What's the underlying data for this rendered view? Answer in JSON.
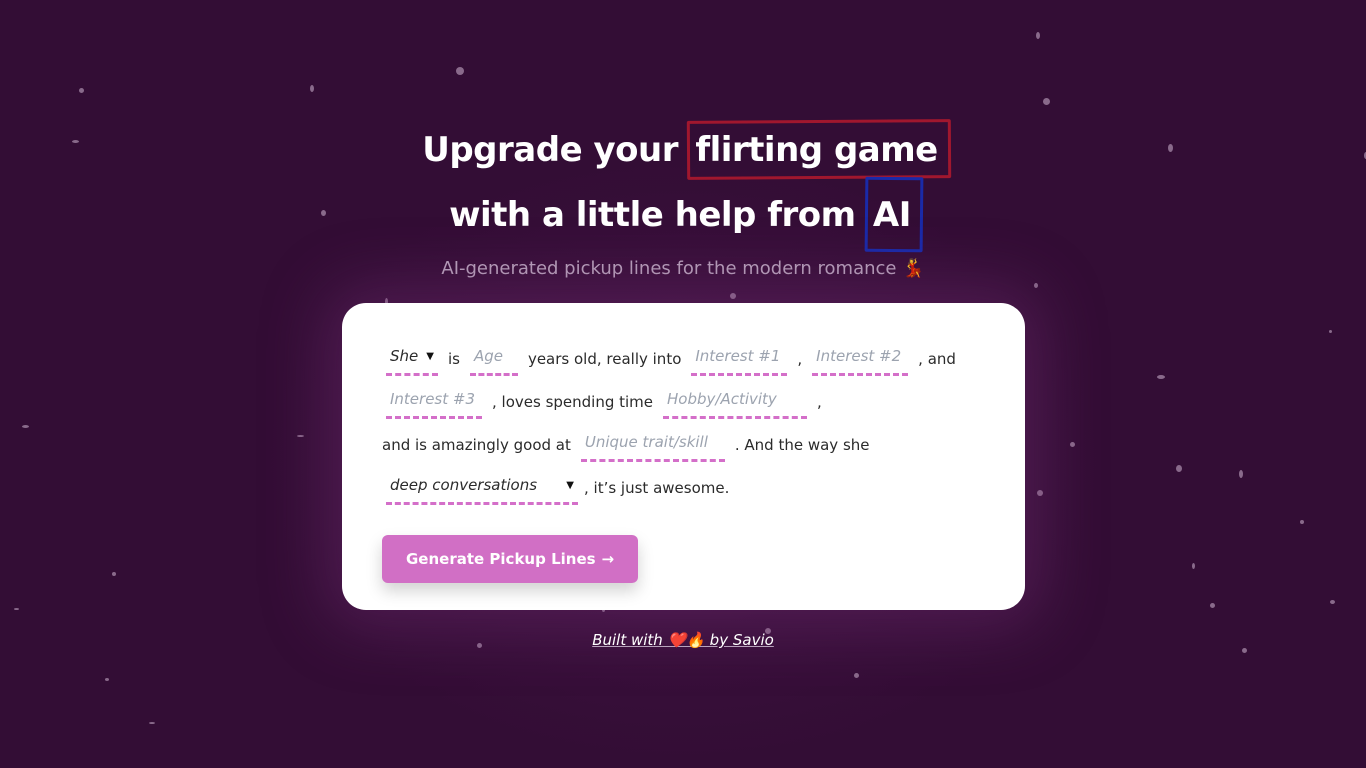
{
  "hero": {
    "title_line1_prefix": "Upgrade your",
    "title_line1_highlight": "flirting game",
    "title_line2_prefix": "with a little help from",
    "title_line2_highlight": "AI",
    "subtitle": "AI-generated pickup lines for the modern romance 💃"
  },
  "form": {
    "pronoun": {
      "value": "She",
      "icon": "chevron-down-icon"
    },
    "text_is": "is",
    "age": {
      "placeholder": "Age"
    },
    "text_years": "years old, really into",
    "interest1": {
      "placeholder": "Interest #1"
    },
    "comma1": ",",
    "interest2": {
      "placeholder": "Interest #2"
    },
    "text_and": ",  and",
    "interest3": {
      "placeholder": "Interest #3"
    },
    "text_loves": ", loves spending time",
    "hobby": {
      "placeholder": "Hobby/Activity"
    },
    "comma2": ",",
    "text_good_at": "and is amazingly good at",
    "trait": {
      "placeholder": "Unique trait/skill"
    },
    "text_way": ". And the way  she",
    "style": {
      "value": "deep conversations",
      "icon": "chevron-down-icon"
    },
    "text_awesome": ", it’s just awesome.",
    "submit_label": "Generate Pickup Lines",
    "submit_icon": "→"
  },
  "footer": {
    "credit": "Built with ❤️🔥 by Savio"
  },
  "colors": {
    "background": "#330d35",
    "accent": "#d16fc5",
    "highlight_red": "#a0172e",
    "highlight_blue": "#1a2aa8"
  }
}
